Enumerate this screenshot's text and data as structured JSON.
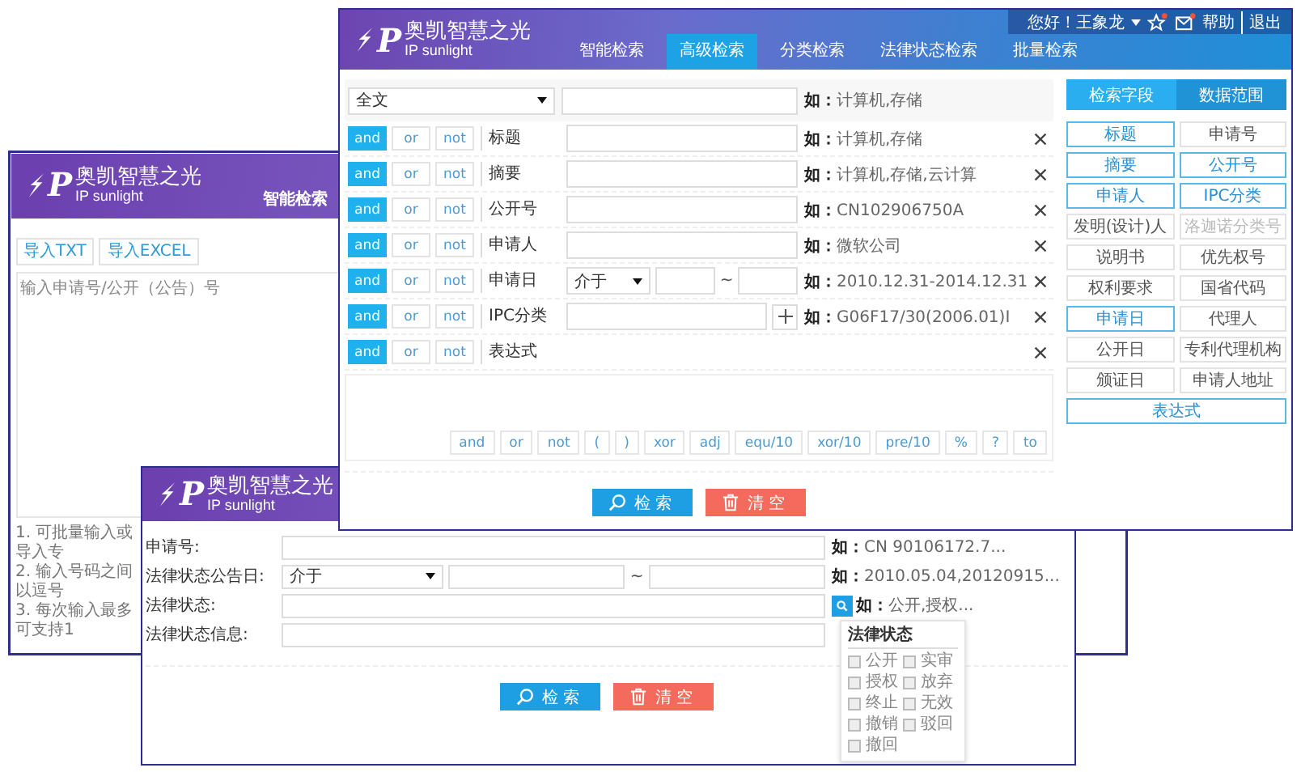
{
  "advanced_window": {
    "logo": {
      "mark": "P",
      "name": "奥凯智慧之光",
      "tagline": "IP sunlight"
    },
    "user": {
      "greeting": "您好！王象龙",
      "links": [
        "帮助",
        "退出"
      ]
    },
    "nav": [
      {
        "label": "智能检索",
        "selected": false
      },
      {
        "label": "高级检索",
        "selected": true
      },
      {
        "label": "分类检索",
        "selected": false
      },
      {
        "label": "法律状态检索",
        "selected": false
      },
      {
        "label": "批量检索",
        "selected": false
      }
    ],
    "scope_select": {
      "value": "全文",
      "hint": "**如：**计算机,存储"
    },
    "rows": [
      {
        "kind": "text",
        "label": "标题",
        "hint": "**如：**计算机,存储",
        "ops": [
          {
            "label": "and",
            "selected": true
          },
          {
            "label": "or",
            "selected": false
          },
          {
            "label": "not",
            "selected": false
          }
        ]
      },
      {
        "kind": "text",
        "label": "摘要",
        "hint": "**如：**计算机,存储,云计算",
        "ops": [
          {
            "label": "and",
            "selected": true
          },
          {
            "label": "or",
            "selected": false
          },
          {
            "label": "not",
            "selected": false
          }
        ]
      },
      {
        "kind": "text",
        "label": "公开号",
        "hint": "**如：**CN102906750A",
        "ops": [
          {
            "label": "and",
            "selected": true
          },
          {
            "label": "or",
            "selected": false
          },
          {
            "label": "not",
            "selected": false
          }
        ]
      },
      {
        "kind": "text",
        "label": "申请人",
        "hint": "**如：**微软公司",
        "ops": [
          {
            "label": "and",
            "selected": true
          },
          {
            "label": "or",
            "selected": false
          },
          {
            "label": "not",
            "selected": false
          }
        ]
      },
      {
        "kind": "date",
        "label": "申请日",
        "select": "介于",
        "separator": "~",
        "hint": "**如：**2010.12.31-2014.12.31",
        "ops": [
          {
            "label": "and",
            "selected": true
          },
          {
            "label": "or",
            "selected": false
          },
          {
            "label": "not",
            "selected": false
          }
        ]
      },
      {
        "kind": "ipc",
        "label": "IPC分类",
        "hint": "**如：**G06F17/30(2006.01)I",
        "ops": [
          {
            "label": "and",
            "selected": true
          },
          {
            "label": "or",
            "selected": false
          },
          {
            "label": "not",
            "selected": false
          }
        ]
      },
      {
        "kind": "expression",
        "label": "表达式",
        "ops": [
          {
            "label": "and",
            "selected": true
          },
          {
            "label": "or",
            "selected": false
          },
          {
            "label": "not",
            "selected": false
          }
        ],
        "operators": [
          "and",
          "or",
          "not",
          "(",
          ")",
          "xor",
          "adj",
          "equ/10",
          "xor/10",
          "pre/10",
          "%",
          "?",
          "to"
        ]
      }
    ],
    "search_button": "检索",
    "clear_button": "清空",
    "panel": {
      "tabs": [
        {
          "label": "检索字段",
          "selected": true
        },
        {
          "label": "数据范围",
          "selected": false
        }
      ],
      "fields": [
        {
          "label": "标题",
          "selected": true,
          "disabled": false
        },
        {
          "label": "申请号",
          "selected": false,
          "disabled": false
        },
        {
          "label": "摘要",
          "selected": true,
          "disabled": false
        },
        {
          "label": "公开号",
          "selected": true,
          "disabled": false
        },
        {
          "label": "申请人",
          "selected": true,
          "disabled": false
        },
        {
          "label": "IPC分类",
          "selected": true,
          "disabled": false
        },
        {
          "label": "发明(设计)人",
          "selected": false,
          "disabled": false
        },
        {
          "label": "洛迦诺分类号",
          "selected": false,
          "disabled": true
        },
        {
          "label": "说明书",
          "selected": false,
          "disabled": false
        },
        {
          "label": "优先权号",
          "selected": false,
          "disabled": false
        },
        {
          "label": "权利要求",
          "selected": false,
          "disabled": false
        },
        {
          "label": "国省代码",
          "selected": false,
          "disabled": false
        },
        {
          "label": "申请日",
          "selected": true,
          "disabled": false
        },
        {
          "label": "代理人",
          "selected": false,
          "disabled": false
        },
        {
          "label": "公开日",
          "selected": false,
          "disabled": false
        },
        {
          "label": "专利代理机构",
          "selected": false,
          "disabled": false
        },
        {
          "label": "颁证日",
          "selected": false,
          "disabled": false
        },
        {
          "label": "申请人地址",
          "selected": false,
          "disabled": false
        },
        {
          "label": "表达式",
          "selected": true,
          "disabled": false
        }
      ]
    }
  },
  "batch_window": {
    "logo": {
      "mark": "P",
      "name": "奥凯智慧之光",
      "tagline": "IP sunlight"
    },
    "tab": "智能检索",
    "import_buttons": [
      "导入TXT",
      "导入EXCEL"
    ],
    "input": {
      "placeholder": "输入申请号/公开（公告）号"
    },
    "notes": [
      "1. 可批量输入或导入专",
      "2. 输入号码之间以逗号",
      "3. 每次输入最多可支持1"
    ]
  },
  "legal_window": {
    "logo": {
      "mark": "P",
      "name": "奥凯智慧之光",
      "tagline": "IP sunlight"
    },
    "rows": [
      {
        "kind": "text",
        "label": "申请号:",
        "hint": "**如：**CN 90106172.7..."
      },
      {
        "kind": "date",
        "label": "法律状态公告日:",
        "select": "介于",
        "separator": "~",
        "hint": "**如：**2010.05.04,20120915..."
      },
      {
        "kind": "lookup",
        "label": "法律状态:",
        "hint": "**如：**公开,授权..."
      },
      {
        "kind": "text",
        "label": "法律状态信息:"
      }
    ],
    "status_picker": {
      "title": "法律状态",
      "options": [
        {
          "label": "公开",
          "checked": false
        },
        {
          "label": "实审",
          "checked": false
        },
        {
          "label": "授权",
          "checked": false
        },
        {
          "label": "放弃",
          "checked": false
        },
        {
          "label": "终止",
          "checked": false
        },
        {
          "label": "无效",
          "checked": false
        },
        {
          "label": "撤销",
          "checked": false
        },
        {
          "label": "驳回",
          "checked": false
        },
        {
          "label": "撤回",
          "checked": false
        }
      ]
    },
    "search_button": "检索",
    "clear_button": "清空"
  }
}
